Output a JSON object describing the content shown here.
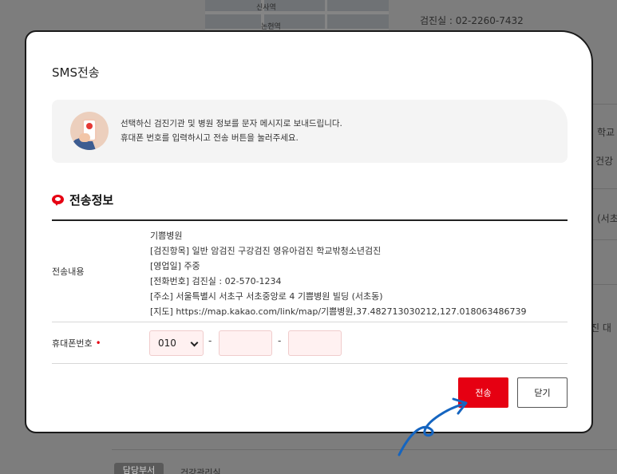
{
  "background": {
    "map_labels": [
      "신사역",
      "논현역"
    ],
    "contact": "검진실 : 02-2260-7432",
    "side_fragments": [
      "학교",
      "건강",
      "(서초",
      "진 대"
    ],
    "bottom_tabs": [
      "담당부서",
      "건강관리실"
    ]
  },
  "modal": {
    "title": "SMS전송",
    "notice": {
      "line1": "선택하신 검진기관 및 병원 정보를 문자 메시지로 보내드립니다.",
      "line2": "휴대폰 번호를 입력하시고 전송 버튼을 눌러주세요."
    },
    "section_title": "전송정보",
    "content_label": "전송내용",
    "content_lines": [
      "기쁨병원",
      "[검진항목] 일반 암검진 구강검진 영유아검진 학교밖청소년검진",
      "[영업일] 주중",
      "[전화번호] 검진실 : 02-570-1234",
      "[주소] 서울특별시 서초구 서초중앙로 4 기쁨병원 빌딩 (서초동)",
      "[지도] https://map.kakao.com/link/map/기쁨병원,37.482713030212,127.018063486739"
    ],
    "phone_label": "휴대폰번호",
    "required_mark": "•",
    "phone_prefix": "010",
    "dash": "-",
    "phone_mid": "",
    "phone_last": "",
    "send_label": "전송",
    "close_label": "닫기"
  },
  "colors": {
    "accent": "#e60012",
    "arrow": "#1565c0"
  }
}
